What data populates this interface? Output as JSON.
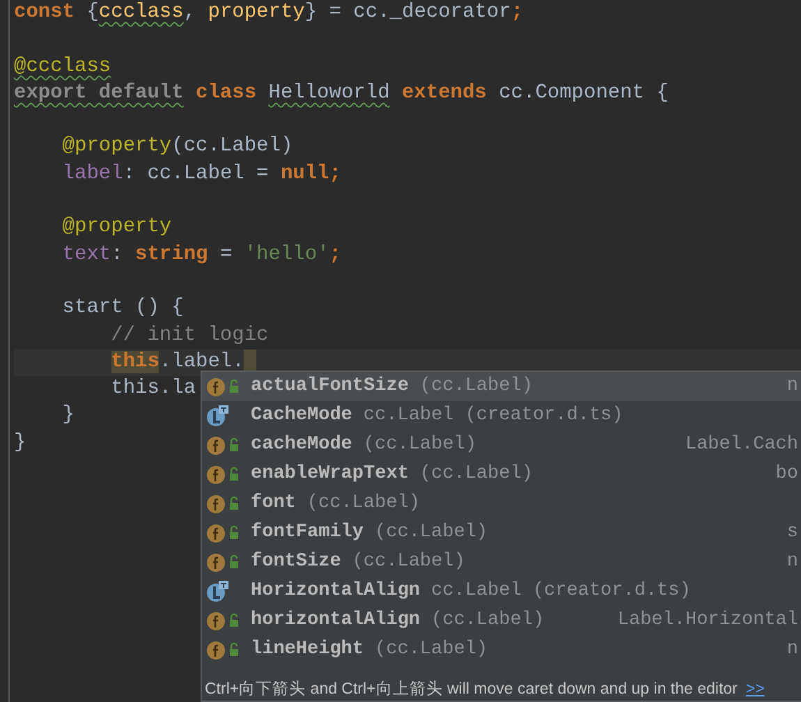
{
  "editor": {
    "lines": [
      {
        "kind": "code",
        "tokens": [
          {
            "kind": "keyword",
            "text": "const"
          },
          {
            "kind": "plain",
            "text": " {"
          },
          {
            "kind": "function",
            "text": "ccclass",
            "warning": true
          },
          {
            "kind": "plain",
            "text": ", "
          },
          {
            "kind": "function",
            "text": "property",
            "warning": false
          },
          {
            "kind": "plain",
            "text": "} = cc._decorator"
          },
          {
            "kind": "keyword",
            "text": ";"
          }
        ]
      },
      {
        "kind": "blank"
      },
      {
        "kind": "code",
        "tokens": [
          {
            "kind": "annotation",
            "text": "@ccclass",
            "warning": true
          }
        ]
      },
      {
        "kind": "code",
        "tokens": [
          {
            "kind": "unused",
            "text": "export default",
            "warning": true
          },
          {
            "kind": "keyword",
            "text": " class "
          },
          {
            "kind": "plain",
            "text": "Helloworld",
            "warning": true
          },
          {
            "kind": "keyword",
            "text": " extends "
          },
          {
            "kind": "plain",
            "text": "cc.Component {"
          }
        ]
      },
      {
        "kind": "blank"
      },
      {
        "kind": "code",
        "tokens": [
          {
            "kind": "annotation",
            "text": "    @property"
          },
          {
            "kind": "plain",
            "text": "(cc.Label)"
          }
        ]
      },
      {
        "kind": "code",
        "tokens": [
          {
            "kind": "field",
            "text": "    label"
          },
          {
            "kind": "plain",
            "text": ": cc.Label = "
          },
          {
            "kind": "keyword",
            "text": "null;"
          }
        ]
      },
      {
        "kind": "blank"
      },
      {
        "kind": "code",
        "tokens": [
          {
            "kind": "annotation",
            "text": "    @property"
          }
        ]
      },
      {
        "kind": "code",
        "tokens": [
          {
            "kind": "field",
            "text": "    text"
          },
          {
            "kind": "plain",
            "text": ": "
          },
          {
            "kind": "keyword",
            "text": "string"
          },
          {
            "kind": "plain",
            "text": " = "
          },
          {
            "kind": "string",
            "text": "'hello'"
          },
          {
            "kind": "keyword",
            "text": ";"
          }
        ]
      },
      {
        "kind": "blank"
      },
      {
        "kind": "code",
        "tokens": [
          {
            "kind": "plain",
            "text": "    start () {"
          }
        ]
      },
      {
        "kind": "code",
        "tokens": [
          {
            "kind": "comment",
            "text": "        // init logic"
          }
        ]
      },
      {
        "kind": "code",
        "current": true,
        "tokens": [
          {
            "kind": "keyword",
            "text": "this",
            "marked": true,
            "indent": true
          },
          {
            "kind": "plain",
            "text": ".label."
          }
        ]
      },
      {
        "kind": "code",
        "tokens": [
          {
            "kind": "plain",
            "text": "        this.la"
          }
        ]
      },
      {
        "kind": "code",
        "tokens": [
          {
            "kind": "plain",
            "text": "    }"
          }
        ]
      },
      {
        "kind": "code",
        "tokens": [
          {
            "kind": "plain",
            "text": "}"
          }
        ]
      }
    ]
  },
  "completion": {
    "items": [
      {
        "kind": "field",
        "name": "actualFontSize",
        "detail": "(cc.Label)",
        "type": "n",
        "selected": true
      },
      {
        "kind": "class",
        "name": "CacheMode",
        "detail": "cc.Label (creator.d.ts)",
        "selected": false
      },
      {
        "kind": "field",
        "name": "cacheMode",
        "detail": "(cc.Label)",
        "type": "Label.Cach",
        "selected": false
      },
      {
        "kind": "field",
        "name": "enableWrapText",
        "detail": "(cc.Label)",
        "type": "bo",
        "selected": false
      },
      {
        "kind": "field",
        "name": "font",
        "detail": "(cc.Label)",
        "selected": false
      },
      {
        "kind": "field",
        "name": "fontFamily",
        "detail": "(cc.Label)",
        "type": "s",
        "selected": false
      },
      {
        "kind": "field",
        "name": "fontSize",
        "detail": "(cc.Label)",
        "type": "n",
        "selected": false
      },
      {
        "kind": "class",
        "name": "HorizontalAlign",
        "detail": "cc.Label (creator.d.ts)",
        "selected": false
      },
      {
        "kind": "field",
        "name": "horizontalAlign",
        "detail": "(cc.Label)",
        "type": "Label.Horizontal",
        "selected": false
      },
      {
        "kind": "field",
        "name": "lineHeight",
        "detail": "(cc.Label)",
        "type": "n",
        "selected": false
      }
    ],
    "hint": "Ctrl+向下箭头 and Ctrl+向上箭头 will move caret down and up in the editor",
    "hint_link": ">>"
  }
}
